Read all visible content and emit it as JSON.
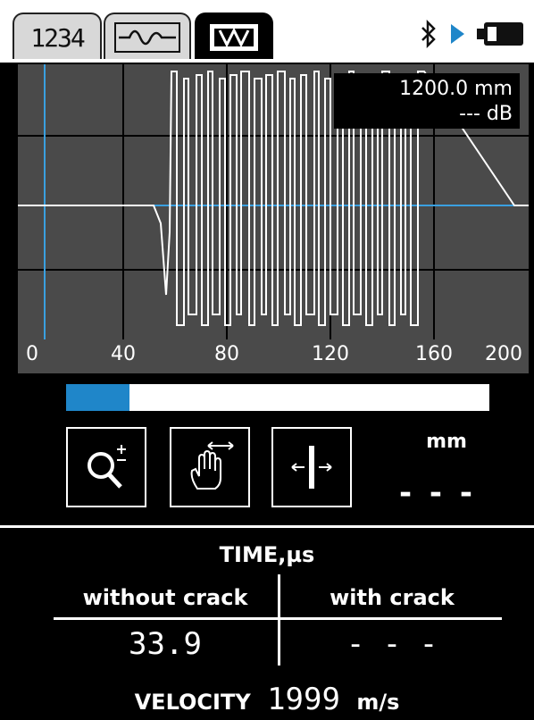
{
  "tabs": [
    {
      "label": "1234",
      "icon": "numeric-display-icon"
    },
    {
      "label": "",
      "icon": "waveform-icon"
    },
    {
      "label": "",
      "icon": "scope-view-icon"
    }
  ],
  "status": {
    "bluetooth": "bluetooth-icon",
    "play": "play-icon",
    "battery": "battery-icon",
    "accent": "#1f86c9"
  },
  "scope": {
    "readout_distance": "1200.0 mm",
    "readout_db": "--- dB",
    "axis_ticks": [
      "0",
      "40",
      "80",
      "120",
      "160",
      "200"
    ],
    "baseline_color": "#3aa0e0"
  },
  "progress": {
    "fraction": 0.15
  },
  "controls": {
    "unit_label": "mm",
    "unit_value": "- - -"
  },
  "results": {
    "title": "TIME,µs",
    "without_crack_label": "without crack",
    "with_crack_label": "with crack",
    "without_crack_value": "33.9",
    "with_crack_value": "- - -",
    "velocity_label": "VELOCITY",
    "velocity_value": "1999",
    "velocity_unit": "m/s"
  }
}
